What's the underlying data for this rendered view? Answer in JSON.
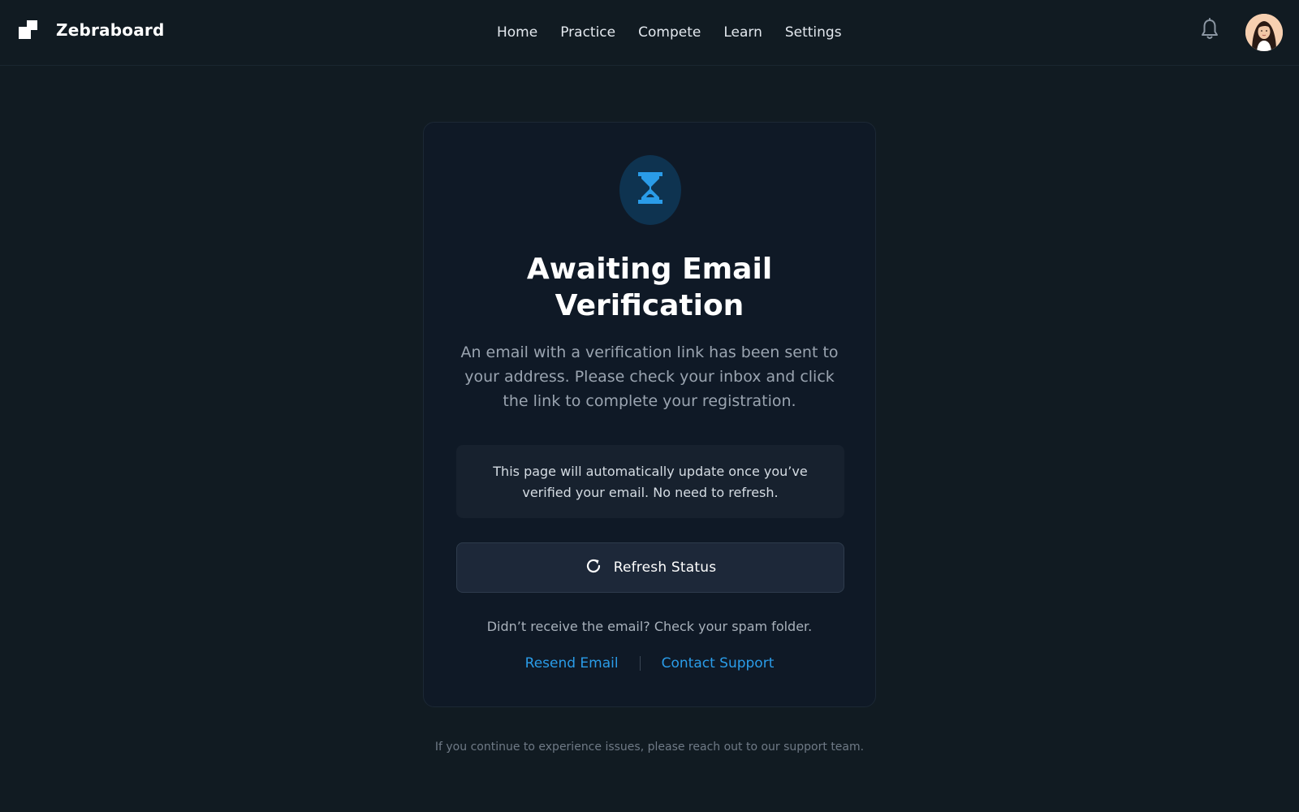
{
  "brand": {
    "name": "Zebraboard"
  },
  "nav": {
    "items": [
      {
        "label": "Home"
      },
      {
        "label": "Practice"
      },
      {
        "label": "Compete"
      },
      {
        "label": "Learn"
      },
      {
        "label": "Settings"
      }
    ]
  },
  "header": {
    "notification_icon": "bell-icon",
    "avatar_icon": "user-avatar"
  },
  "card": {
    "status_icon": "hourglass-icon",
    "title": "Awaiting Email Verification",
    "description": "An email with a verification link has been sent to your address. Please check your inbox and click the link to complete your registration.",
    "info": "This page will automatically update once you’ve verified your email. No need to refresh.",
    "refresh_button": {
      "label": "Refresh Status",
      "icon": "refresh-icon"
    },
    "spam_note": "Didn’t receive the email? Check your spam folder.",
    "links": {
      "resend": "Resend Email",
      "support": "Contact Support"
    }
  },
  "footer": {
    "note": "If you continue to experience issues, please reach out to our support team."
  },
  "colors": {
    "background": "#111b22",
    "card": "#0f1926",
    "accent": "#2a9ce8",
    "icon_circle": "#0e3350"
  }
}
